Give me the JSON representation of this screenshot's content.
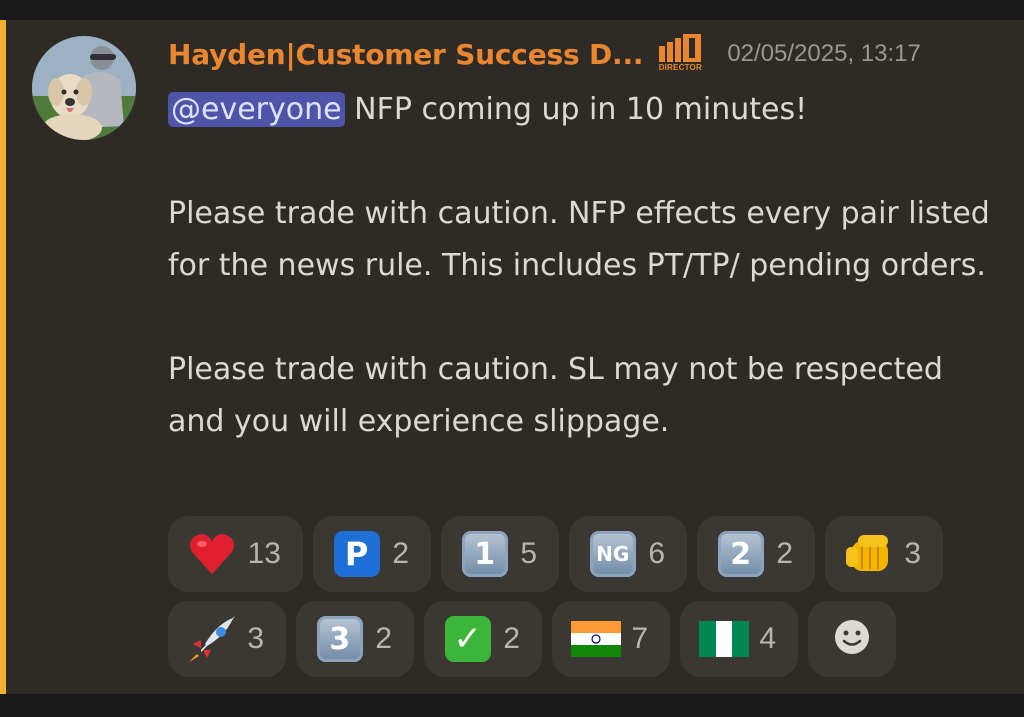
{
  "message": {
    "username": "Hayden|Customer Success D...",
    "role_badge": "DIRECTOR",
    "timestamp": "02/05/2025, 13:17",
    "mention": "@everyone",
    "line1_rest": " NFP coming up in 10 minutes!",
    "para2": "Please trade with caution. NFP effects every pair listed for the news rule. This includes PT/TP/ pending orders.",
    "para3": "Please trade with caution. SL may not be respected and you will experience slippage."
  },
  "reactions": [
    {
      "icon": "red-heart-emoji",
      "count": "13"
    },
    {
      "icon": "p-button-emoji",
      "label": "P",
      "count": "2"
    },
    {
      "icon": "keycap-1-emoji",
      "label": "1",
      "count": "5"
    },
    {
      "icon": "ng-button-emoji",
      "label": "NG",
      "count": "6"
    },
    {
      "icon": "keycap-2-emoji",
      "label": "2",
      "count": "2"
    },
    {
      "icon": "oncoming-fist-emoji",
      "count": "3"
    },
    {
      "icon": "rocket-emoji",
      "count": "3"
    },
    {
      "icon": "keycap-3-emoji",
      "label": "3",
      "count": "2"
    },
    {
      "icon": "check-mark-button-emoji",
      "label": "✓",
      "count": "2"
    },
    {
      "icon": "india-flag-emoji",
      "count": "7"
    },
    {
      "icon": "nigeria-flag-emoji",
      "count": "4"
    }
  ],
  "add_reaction": {
    "icon": "add-reaction-smiley-icon"
  },
  "colors": {
    "accent_bar": "#f0b232",
    "username": "#e9862f",
    "mention_bg": "#4e55a8",
    "message_bg": "#2e2b26"
  }
}
